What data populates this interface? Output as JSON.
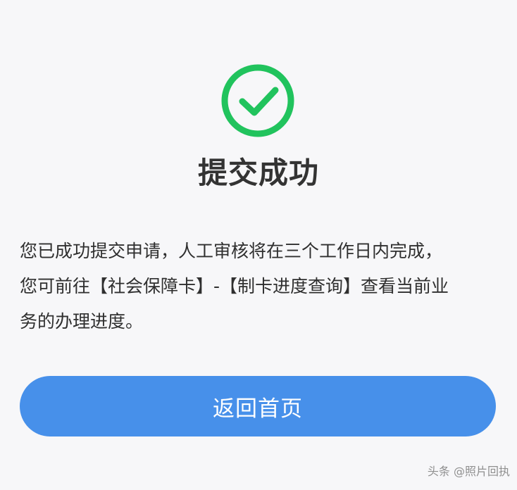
{
  "status": {
    "icon": "check-circle-icon",
    "title": "提交成功"
  },
  "message": {
    "lines": [
      "您已成功提交申请，人工审核将在三个工作日内完成，",
      "您可前往【社会保障卡】-【制卡进度查询】查看当前业",
      "务的办理进度。"
    ]
  },
  "actions": {
    "home_label": "返回首页"
  },
  "watermark": {
    "text": "头条 @照片回执"
  },
  "colors": {
    "success": "#21c35d",
    "primary": "#4790ea",
    "background": "#f7f7f9",
    "text": "#333333"
  }
}
